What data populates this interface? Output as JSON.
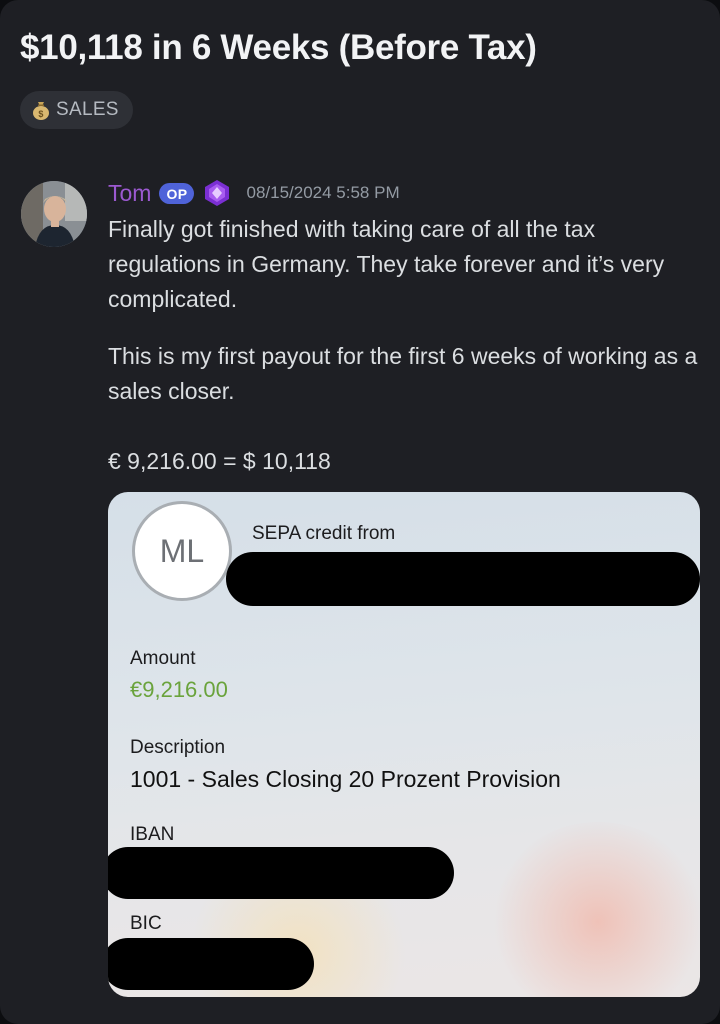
{
  "thread": {
    "title": "$10,118 in 6 Weeks (Before Tax)",
    "tag_label": "SALES",
    "tag_icon": "money-bag-icon"
  },
  "message": {
    "username": "Tom",
    "op_badge": "OP",
    "timestamp": "08/15/2024 5:58 PM",
    "paragraphs": [
      "Finally got finished with taking care of all the tax regulations in Germany. They take forever and it’s very complicated.",
      "This is my first payout for the first 6 weeks of working as a sales closer.",
      "€ 9,216.00 = $ 10,118"
    ]
  },
  "bank_card": {
    "avatar_initials": "ML",
    "sepa_label": "SEPA credit from",
    "amount_label": "Amount",
    "amount_value": "€9,216.00",
    "description_label": "Description",
    "description_value": "1001 - Sales Closing 20 Prozent Provision",
    "iban_label": "IBAN",
    "bic_label": "BIC"
  },
  "colors": {
    "username": "#9b59d0",
    "op_badge": "#4f63d9",
    "amount": "#6aa33c",
    "background": "#1e1f24"
  }
}
